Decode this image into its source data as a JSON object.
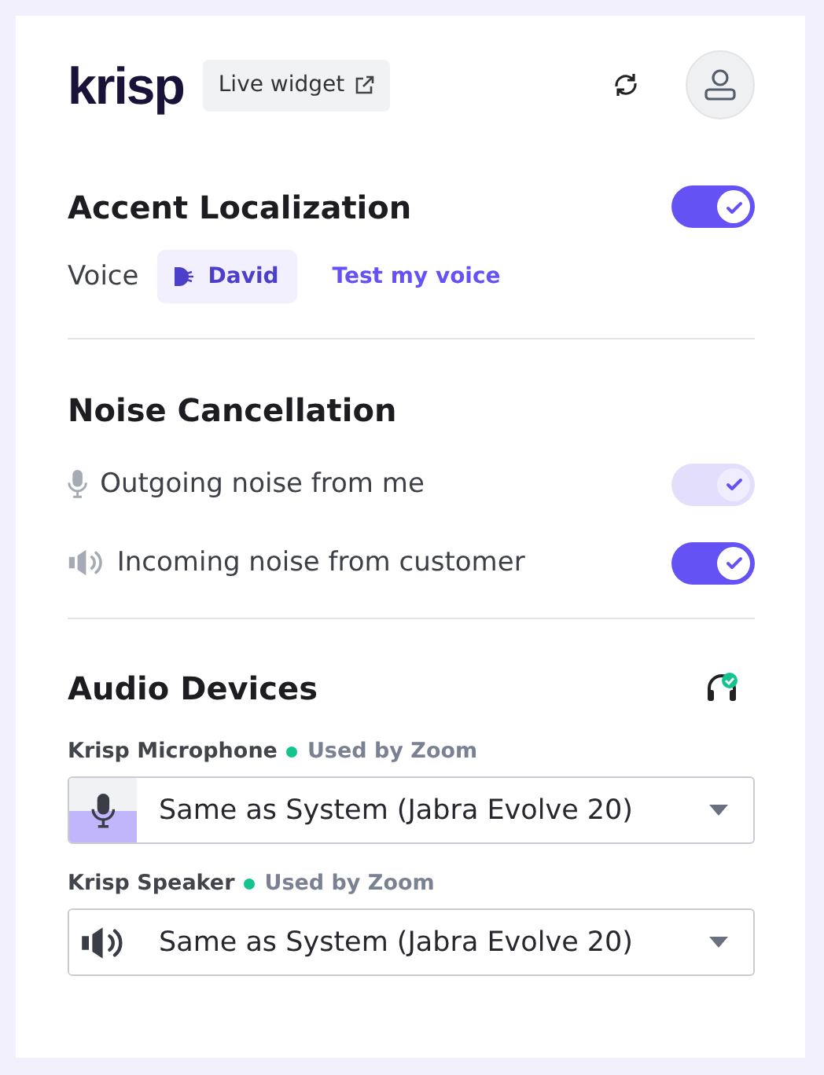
{
  "header": {
    "logo": "krisp",
    "live_widget": "Live widget"
  },
  "accent": {
    "title": "Accent Localization",
    "on": true,
    "disabled": false,
    "voice_label": "Voice",
    "voice": "David",
    "test_link": "Test my voice"
  },
  "noise": {
    "title": "Noise Cancellation",
    "items": [
      {
        "kind": "mic",
        "label": "Outgoing noise from me",
        "on": true,
        "disabled": true
      },
      {
        "kind": "speaker",
        "label": "Incoming noise from customer",
        "on": true,
        "disabled": false
      }
    ]
  },
  "devices": {
    "title": "Audio Devices",
    "items": [
      {
        "kind": "mic",
        "name": "Krisp Microphone",
        "status": "Used by Zoom",
        "color": "#14c38e",
        "value": "Same as System (Jabra Evolve 20)"
      },
      {
        "kind": "speaker",
        "name": "Krisp Speaker",
        "status": "Used by Zoom",
        "color": "#14c38e",
        "value": "Same as System (Jabra Evolve 20)"
      }
    ]
  }
}
